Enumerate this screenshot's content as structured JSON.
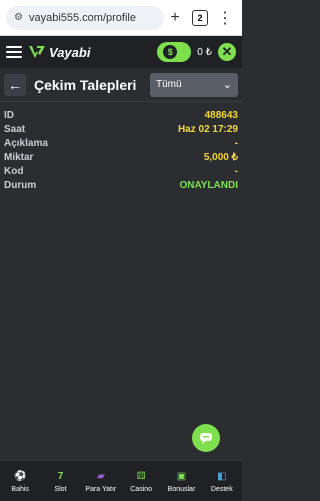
{
  "browser": {
    "url": "vayabi555.com/profile",
    "tab_count": "2"
  },
  "app": {
    "brand": "Vayabi",
    "balance": "0 ₺",
    "colors": {
      "accent": "#7ee04f",
      "value": "#f4d83b",
      "bg": "#2b2d31",
      "header": "#1f2125"
    }
  },
  "page": {
    "title": "Çekim Talepleri",
    "filter_selected": "Tümü"
  },
  "details": [
    {
      "key": "ID",
      "value": "488643"
    },
    {
      "key": "Saat",
      "value": "Haz 02 17:29"
    },
    {
      "key": "Açıklama",
      "value": "-"
    },
    {
      "key": "Miktar",
      "value": "5,000 ₺"
    },
    {
      "key": "Kod",
      "value": "-"
    },
    {
      "key": "Durum",
      "value": "ONAYLANDI"
    }
  ],
  "bottom_nav": [
    {
      "label": "Bahis",
      "icon": "football-icon"
    },
    {
      "label": "Slot",
      "icon": "seven-icon"
    },
    {
      "label": "Para Yatır",
      "icon": "wallet-icon"
    },
    {
      "label": "Casino",
      "icon": "dice-icon"
    },
    {
      "label": "Bonuslar",
      "icon": "gift-icon"
    },
    {
      "label": "Destek",
      "icon": "support-icon"
    }
  ]
}
